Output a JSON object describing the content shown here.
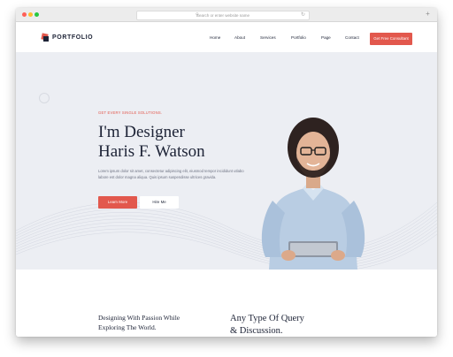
{
  "browser": {
    "url_placeholder": "Search or enter website name"
  },
  "header": {
    "logo_text": "PORTFOLIO",
    "menu": [
      "Home",
      "About",
      "Services",
      "Portfolio",
      "Page",
      "Contact"
    ],
    "cta_label": "Get Free Consultant"
  },
  "hero": {
    "tagline": "GET EVERY SINGLE SOLUTIONS.",
    "headline_line1": "I'm Designer",
    "headline_line2": "Haris F. Watson",
    "description": "Lorem ipsum dolor sit amet, consectetur adipiscing elit, eiusmod tempor incididunt utlabo labore est dolor magna aliqua. Quis ipsum suspendisse ultrices gravida.",
    "primary_button": "Learn More",
    "secondary_button": "Hire Me"
  },
  "section2": {
    "left_line1": "Designing With Passion While",
    "left_line2": "Exploring The World.",
    "right_line1": "Any Type Of Query",
    "right_line2": "& Discussion."
  },
  "colors": {
    "accent": "#e2584d",
    "navy": "#1d2336",
    "hero_bg": "#eceef3"
  },
  "icons": [
    "search-icon",
    "reload-icon",
    "plus-icon",
    "logo-icon"
  ]
}
